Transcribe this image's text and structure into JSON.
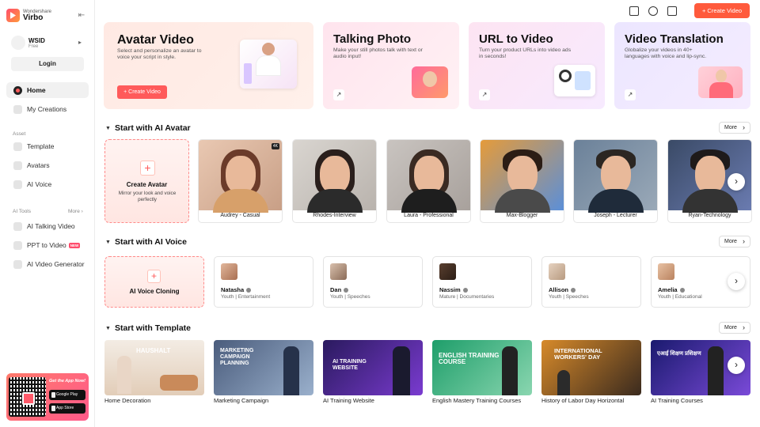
{
  "brand": {
    "small": "Wondershare",
    "name": "Virbo"
  },
  "profile": {
    "name": "WSID",
    "plan": "Free",
    "login": "Login"
  },
  "nav": {
    "home": "Home",
    "my_creations": "My Creations",
    "asset_label": "Asset",
    "template": "Template",
    "avatars": "Avatars",
    "ai_voice": "AI Voice",
    "tools_label": "AI Tools",
    "tools_more": "More ›",
    "talking_video": "AI Talking Video",
    "ppt_to_video": "PPT to Video",
    "ppt_tag": "NEW",
    "video_generator": "AI Video Generator"
  },
  "promo": {
    "title": "Get the App Now!",
    "google": "Google Play",
    "apple": "App Store"
  },
  "topbar": {
    "create": "+ Create Video"
  },
  "hero": [
    {
      "title": "Avatar Video",
      "desc": "Select and personalize an avatar to voice your script in style.",
      "button": "+ Create Video"
    },
    {
      "title": "Talking Photo",
      "desc": "Make your still photos talk with text or audio input!"
    },
    {
      "title": "URL to Video",
      "desc": "Turn your product URLs into video ads in seconds!"
    },
    {
      "title": "Video Translation",
      "desc": "Globalize your videos in 40+ languages with voice and lip-sync."
    }
  ],
  "sections": {
    "avatar": "Start with AI Avatar",
    "voice": "Start with AI Voice",
    "template": "Start with Template",
    "more": "More"
  },
  "create_avatar": {
    "title": "Create Avatar",
    "sub": "Mirror your look and voice perfectly"
  },
  "avatars": [
    {
      "name": "Audrey - Casual",
      "badge": "4K"
    },
    {
      "name": "Rhodes-Interview"
    },
    {
      "name": "Laura - Professional"
    },
    {
      "name": "Max-Blogger"
    },
    {
      "name": "Joseph - Lecturer"
    },
    {
      "name": "Ryan-Technology"
    }
  ],
  "voice_clone": {
    "title": "AI Voice Cloning"
  },
  "voices": [
    {
      "name": "Natasha",
      "tags": "Youth | Entertainment"
    },
    {
      "name": "Dan",
      "tags": "Youth | Speeches"
    },
    {
      "name": "Nassim",
      "tags": "Mature | Documentaries"
    },
    {
      "name": "Allison",
      "tags": "Youth | Speeches"
    },
    {
      "name": "Amelia",
      "tags": "Youth | Educational"
    }
  ],
  "templates": [
    {
      "name": "Home Decoration",
      "overlay": "HAUSHALT"
    },
    {
      "name": "Marketing Campaign",
      "overlay": "MARKETING CAMPAIGN PLANNING"
    },
    {
      "name": "AI Training Website",
      "overlay": "AI TRAINING WEBSITE"
    },
    {
      "name": "English Mastery Training Courses",
      "overlay": "ENGLISH TRAINING COURSE"
    },
    {
      "name": "History of Labor Day Horizontal",
      "overlay": "INTERNATIONAL WORKERS' DAY"
    },
    {
      "name": "AI Training Courses",
      "overlay": "एआई शिक्षण प्रशिक्षण"
    }
  ]
}
